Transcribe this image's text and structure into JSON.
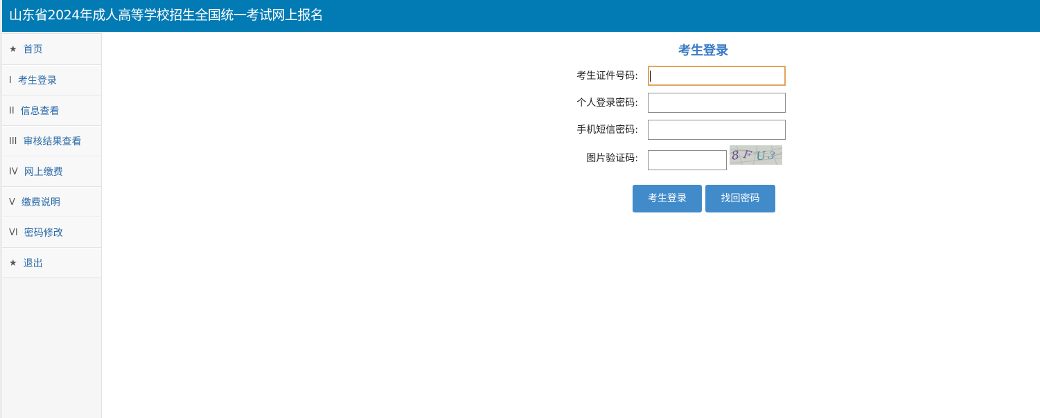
{
  "header": {
    "title": "山东省2024年成人高等学校招生全国统一考试网上报名"
  },
  "sidebar": {
    "items": [
      {
        "prefix": "★",
        "label": "首页"
      },
      {
        "prefix": "I",
        "label": "考生登录"
      },
      {
        "prefix": "II",
        "label": "信息查看"
      },
      {
        "prefix": "III",
        "label": "审核结果查看"
      },
      {
        "prefix": "IV",
        "label": "网上缴费"
      },
      {
        "prefix": "V",
        "label": "缴费说明"
      },
      {
        "prefix": "VI",
        "label": "密码修改"
      },
      {
        "prefix": "★",
        "label": "退出"
      }
    ]
  },
  "login": {
    "title": "考生登录",
    "id_label": "考生证件号码:",
    "id_value": "",
    "password_label": "个人登录密码:",
    "password_value": "",
    "sms_label": "手机短信密码:",
    "sms_value": "",
    "captcha_label": "图片验证码:",
    "captcha_value": "",
    "captcha_text": "8FU3",
    "login_button": "考生登录",
    "recover_button": "找回密码"
  },
  "colors": {
    "header_bg": "#027bb5",
    "link_blue": "#2a6aa8",
    "title_blue": "#3a7bc4",
    "button_blue": "#428bca",
    "focus_border": "#e0a55a"
  }
}
